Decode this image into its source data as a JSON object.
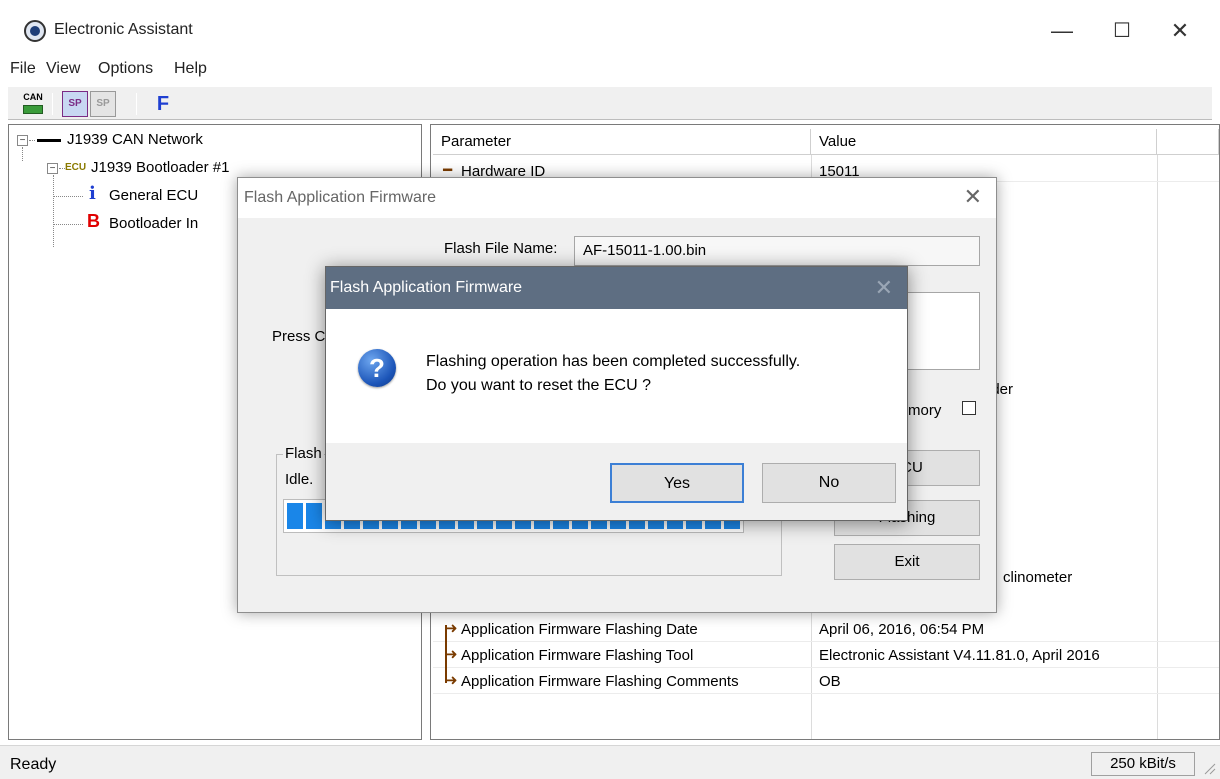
{
  "window": {
    "title": "Electronic Assistant",
    "min": "—",
    "max": "☐",
    "close": "✕"
  },
  "menu": [
    "File",
    "View",
    "Options",
    "Help"
  ],
  "toolbar": {
    "can_label": "CAN",
    "sp_label": "SP",
    "f_label": "F"
  },
  "tree": {
    "root": "J1939 CAN Network",
    "ecu_prefix": "ECU",
    "ecu": "J1939 Bootloader #1",
    "info_icon": "i",
    "info_label": "General ECU",
    "boot_icon": "B",
    "boot_label": "Bootloader In",
    "expander": "−"
  },
  "table": {
    "headers": [
      "Parameter",
      "Value"
    ],
    "rows": [
      {
        "param": "Hardware ID",
        "value": "15011"
      },
      {
        "param": "Application Firmware Flashing Date",
        "value": "April 06, 2016, 06:54 PM"
      },
      {
        "param": "Application Firmware Flashing Tool",
        "value": "Electronic Assistant V4.11.81.0, April 2016"
      },
      {
        "param": "Application Firmware Flashing Comments",
        "value": "OB"
      }
    ],
    "partial_ader": "ader",
    "partial_inclinometer": "clinometer"
  },
  "flash_dialog": {
    "title": "Flash Application Firmware",
    "close": "✕",
    "file_label": "Flash File Name:",
    "file_value": "AF-15011-1.00.bin",
    "press_text": "Press C",
    "memory_label": "mory",
    "group_title": "Flash",
    "status": "Idle.",
    "progress_fraction": 1.0,
    "btn_reset_ecu": "ECU",
    "btn_flashing": "Flashing",
    "btn_exit": "Exit"
  },
  "confirm_dialog": {
    "title": "Flash Application Firmware",
    "close": "✕",
    "icon": "?",
    "line1": "Flashing operation has been completed successfully.",
    "line2": "Do you want to reset the ECU ?",
    "yes": "Yes",
    "no": "No"
  },
  "status": {
    "text": "Ready",
    "baud": "250 kBit/s"
  },
  "colors": {
    "accent": "#1a86e8",
    "dialog_title": "#5e6e82",
    "tree_red": "#e00000",
    "tree_blue": "#1f3fd1"
  }
}
